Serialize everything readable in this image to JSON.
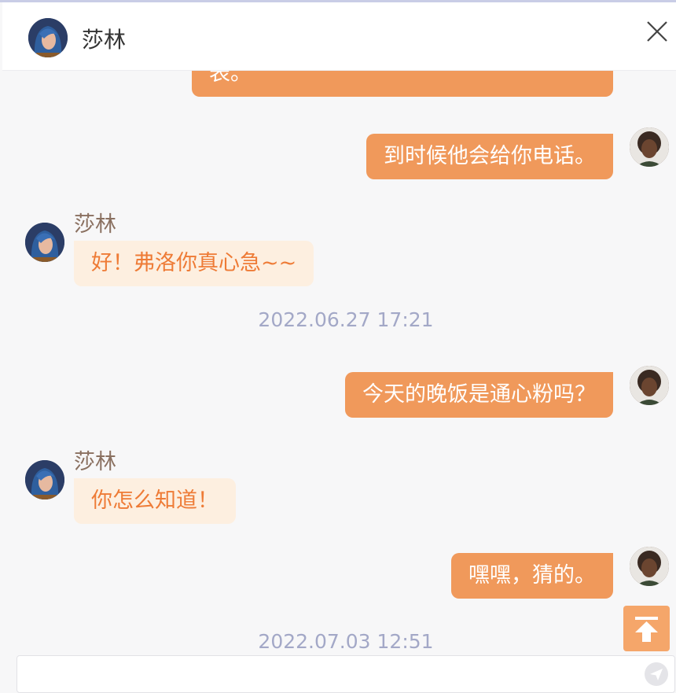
{
  "header": {
    "contact_name": "莎林"
  },
  "messages": {
    "m0": "表。",
    "m1": "到时候他会给你电话。",
    "m2_sender": "莎林",
    "m2": "好！弗洛你真心急~~",
    "ts1": "2022.06.27  17:21",
    "m3": "今天的晚饭是通心粉吗？",
    "m4_sender": "莎林",
    "m4": "你怎么知道！",
    "m5": "嘿嘿，猜的。",
    "ts2": "2022.07.03  12:51"
  },
  "input": {
    "value": "",
    "placeholder": ""
  },
  "colors": {
    "outgoing_bubble": "#f0995b",
    "incoming_bubble": "#fdefe0",
    "incoming_text": "#ee7b36",
    "timestamp": "#a3a8c7",
    "scroll_button": "#f5a66a"
  },
  "icons": {
    "close": "close-icon",
    "scroll_top": "arrow-up-to-top-icon",
    "send": "send-icon"
  }
}
